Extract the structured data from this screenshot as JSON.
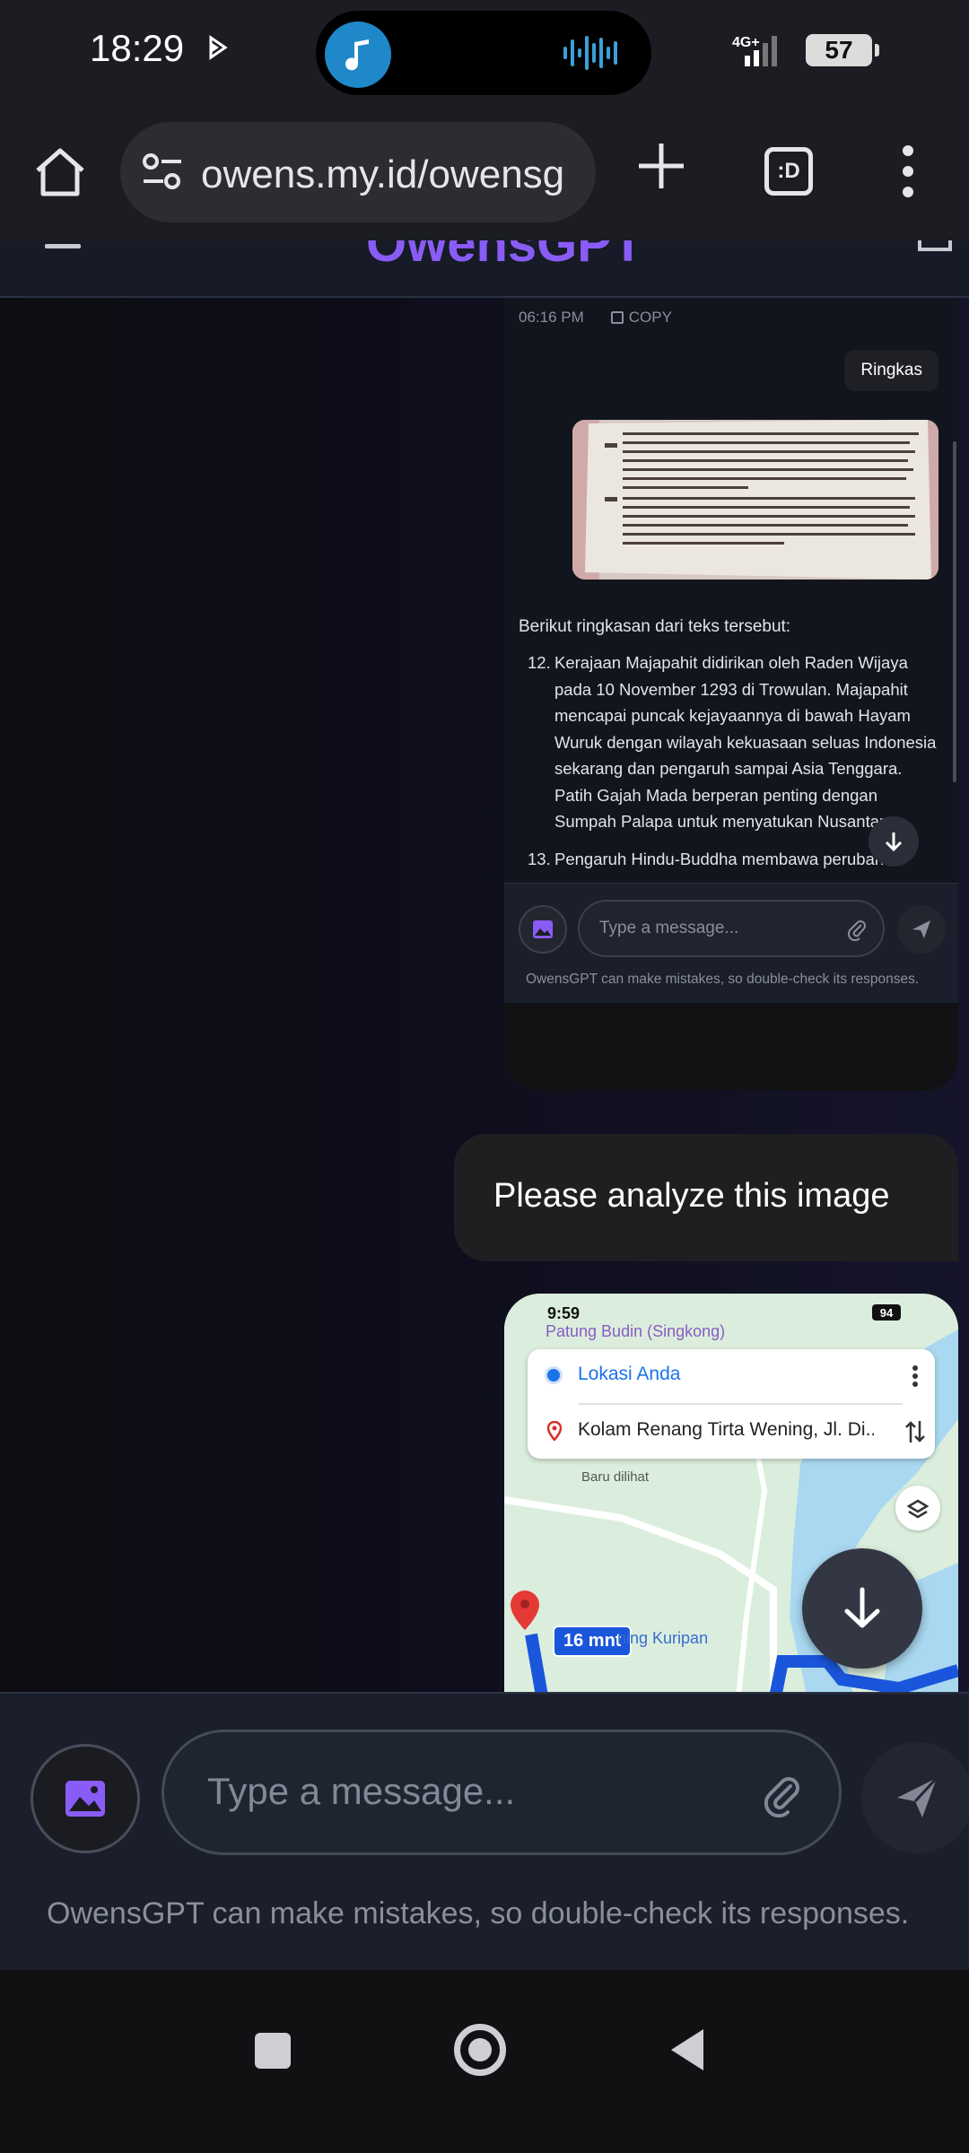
{
  "status_bar": {
    "time": "18:29",
    "network": "4G+",
    "battery": "57"
  },
  "browser": {
    "url": "owens.my.id/owensg",
    "tabs_label": ":D"
  },
  "app": {
    "title": "OwensGPT",
    "accent_color": "#8a5cf6"
  },
  "screenshot_message": {
    "time": "06:16 PM",
    "copy_label": "COPY",
    "user_prompt": "Ringkas",
    "intro": "Berikut ringkasan dari teks tersebut:",
    "items": [
      {
        "number": "12.",
        "text": "Kerajaan Majapahit didirikan oleh Raden Wijaya pada 10 November 1293 di Trowulan. Majapahit mencapai puncak kejayaannya di bawah Hayam Wuruk dengan wilayah kekuasaan seluas Indonesia sekarang dan pengaruh sampai Asia Tenggara. Patih Gajah Mada berperan penting dengan Sumpah Palapa untuk menyatukan Nusantara."
      },
      {
        "number": "13.",
        "text": "Pengaruh Hindu-Buddha membawa perubahan"
      }
    ],
    "input_placeholder": "Type a message...",
    "disclaimer": "OwensGPT can make mistakes, so double-check its responses.",
    "photo_icon": "photo-of-textbook-page"
  },
  "user_message": {
    "text": "Please analyze this image"
  },
  "map_screenshot": {
    "time": "9:59",
    "battery": "94",
    "place_top": "Patung Budin (Singkong)",
    "origin": "Lokasi Anda",
    "destination": "Kolam Renang Tirta Wening, Jl. Di...",
    "small_label": "Baru dilihat",
    "eta": "16 mnt",
    "place_bottom": "ning Kuripan"
  },
  "composer": {
    "placeholder": "Type a message...",
    "disclaimer": "OwensGPT can make mistakes, so double-check its responses."
  },
  "icons": {
    "home": "home-icon",
    "tune": "site-settings-icon",
    "plus": "new-tab-icon",
    "menu": "overflow-menu-icon",
    "image": "image-upload-icon",
    "attach": "paperclip-icon",
    "send": "send-icon",
    "scroll": "arrow-down-icon"
  }
}
